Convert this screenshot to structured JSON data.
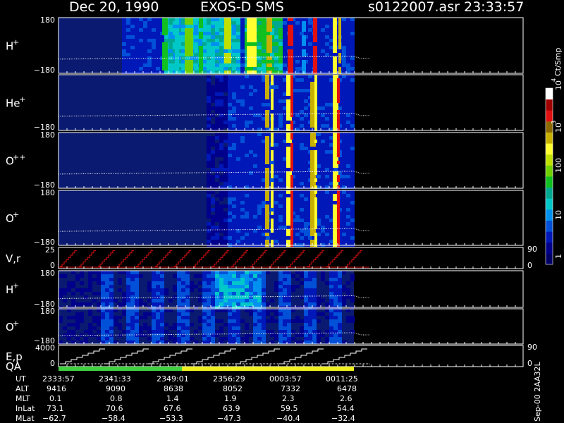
{
  "header": {
    "date": "Dec 20, 1990",
    "instrument": "EXOS-D SMS",
    "file": "s0122007.asr",
    "time": "23:33:57"
  },
  "colorbar": {
    "label": "Ct/Smp",
    "ticks": [
      "1",
      "10",
      "100",
      "10",
      "10"
    ],
    "tick_exponents": [
      "",
      "",
      "",
      "3",
      "4"
    ],
    "colors": [
      "#000066",
      "#00008a",
      "#0018b8",
      "#0050d8",
      "#0090f0",
      "#00c8c8",
      "#00a890",
      "#10c020",
      "#70d000",
      "#c0e000",
      "#ffff30",
      "#c8b000",
      "#8c6a00",
      "#e01010",
      "#a00000",
      "#ffffff"
    ]
  },
  "panels": [
    {
      "name": "h-plus-1",
      "label": "H",
      "sup": "+",
      "ymax": "180",
      "ymin": "−180"
    },
    {
      "name": "he-plus",
      "label": "He",
      "sup": "+",
      "ymax": "",
      "ymin": "−180"
    },
    {
      "name": "o-plusplus",
      "label": "O",
      "sup": "++",
      "ymax": "180",
      "ymin": "−180"
    },
    {
      "name": "o-plus-1",
      "label": "O",
      "sup": "+",
      "ymax": "180",
      "ymin": "−180"
    },
    {
      "name": "vr",
      "label": "V,r",
      "sup": "",
      "ymax": "25",
      "ymin": "0",
      "rtop": "90",
      "rbot": "0"
    },
    {
      "name": "h-plus-2",
      "label": "H",
      "sup": "+",
      "ymax": "180",
      "ymin": "−180"
    },
    {
      "name": "o-plus-2",
      "label": "O",
      "sup": "+",
      "ymax": "180",
      "ymin": "−180"
    },
    {
      "name": "ep",
      "label": "E,p",
      "sup": "",
      "ymax": "4000",
      "ymin": "0",
      "rtop": "90",
      "rbot": "0"
    }
  ],
  "qa_label": "QA",
  "footer": {
    "rows": [
      {
        "label": "UT",
        "values": [
          "2333:57",
          "2341:33",
          "2349:01",
          "2356:29",
          "0003:57",
          "0011:25"
        ]
      },
      {
        "label": "ALT",
        "values": [
          "9416",
          "9090",
          "8638",
          "8052",
          "7332",
          "6478"
        ]
      },
      {
        "label": "MLT",
        "values": [
          "0.1",
          "0.8",
          "1.4",
          "1.9",
          "2.3",
          "2.6"
        ]
      },
      {
        "label": "InLat",
        "values": [
          "73.1",
          "70.6",
          "67.6",
          "63.9",
          "59.5",
          "54.4"
        ]
      },
      {
        "label": "MLat",
        "values": [
          "−62.7",
          "−58.4",
          "−53.3",
          "−47.3",
          "−40.4",
          "−32.4"
        ]
      }
    ],
    "side_label": "Sep-00 2AA32L"
  },
  "chart_data": {
    "type": "heatmap",
    "title": "Dec 20, 1990   EXOS-D SMS",
    "x": [
      "2333:57",
      "2341:33",
      "2349:01",
      "2356:29",
      "0003:57",
      "0011:25"
    ],
    "panel_y_range": [
      -180,
      180
    ],
    "vr_range": [
      0,
      25
    ],
    "ep_range": [
      0,
      4000
    ],
    "right_axis_range": [
      0,
      90
    ],
    "colorbar_range_ct_per_sample": [
      1,
      10000
    ],
    "colorbar_scale": "log",
    "data_coverage": "2333:57 to ~0015:00"
  }
}
